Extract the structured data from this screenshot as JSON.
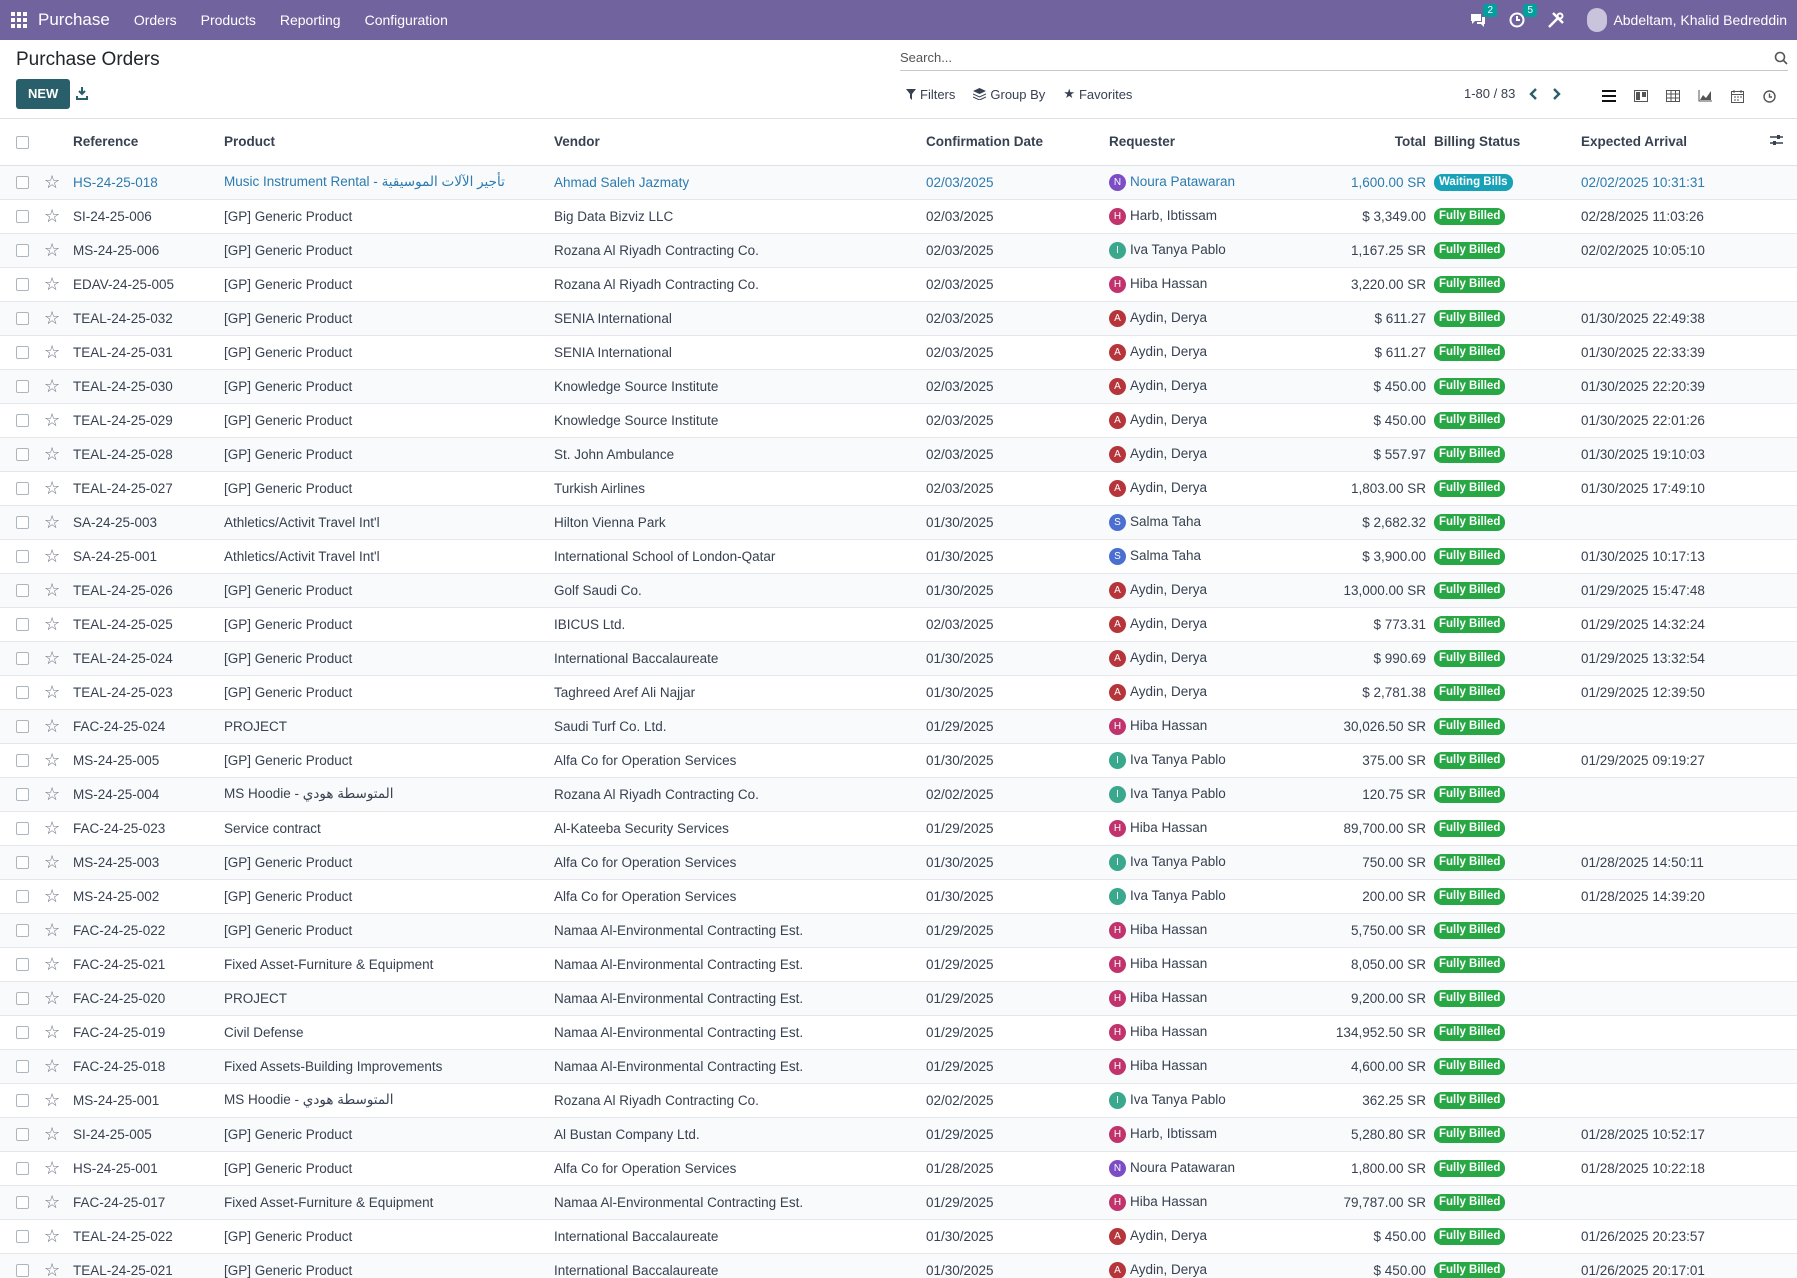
{
  "navbar": {
    "app_name": "Purchase",
    "menu": [
      "Orders",
      "Products",
      "Reporting",
      "Configuration"
    ],
    "messages_count": "2",
    "activities_count": "5",
    "user_name": "Abdeltam, Khalid Bedreddin"
  },
  "control": {
    "title": "Purchase Orders",
    "new_label": "NEW",
    "search_placeholder": "Search...",
    "filters_label": "Filters",
    "groupby_label": "Group By",
    "favorites_label": "Favorites",
    "pager": "1-80 / 83"
  },
  "table": {
    "headers": [
      "Reference",
      "Product",
      "Vendor",
      "Confirmation Date",
      "Requester",
      "Total",
      "Billing Status",
      "Expected Arrival"
    ],
    "rows": [
      {
        "ref": "HS-24-25-018",
        "product": "Music Instrument Rental - تأجير الآلات الموسيقية",
        "vendor": "Ahmad Saleh Jazmaty",
        "date": "02/03/2025",
        "initial": "N",
        "requester": "Noura Patawaran",
        "total": "1,600.00 SR",
        "status": "Waiting Bills",
        "arrival": "02/02/2025 10:31:31",
        "highlight": true
      },
      {
        "ref": "SI-24-25-006",
        "product": "[GP] Generic Product",
        "vendor": "Big Data Bizviz LLC",
        "date": "02/03/2025",
        "initial": "H",
        "requester": "Harb, Ibtissam",
        "total": "$ 3,349.00",
        "status": "Fully Billed",
        "arrival": "02/28/2025 11:03:26"
      },
      {
        "ref": "MS-24-25-006",
        "product": "[GP] Generic Product",
        "vendor": "Rozana Al Riyadh Contracting Co.",
        "date": "02/03/2025",
        "initial": "I",
        "requester": "Iva Tanya Pablo",
        "total": "1,167.25 SR",
        "status": "Fully Billed",
        "arrival": "02/02/2025 10:05:10"
      },
      {
        "ref": "EDAV-24-25-005",
        "product": "[GP] Generic Product",
        "vendor": "Rozana Al Riyadh Contracting Co.",
        "date": "02/03/2025",
        "initial": "H",
        "requester": "Hiba Hassan",
        "total": "3,220.00 SR",
        "status": "Fully Billed",
        "arrival": ""
      },
      {
        "ref": "TEAL-24-25-032",
        "product": "[GP] Generic Product",
        "vendor": "SENIA International",
        "date": "02/03/2025",
        "initial": "A",
        "requester": "Aydin, Derya",
        "total": "$ 611.27",
        "status": "Fully Billed",
        "arrival": "01/30/2025 22:49:38"
      },
      {
        "ref": "TEAL-24-25-031",
        "product": "[GP] Generic Product",
        "vendor": "SENIA International",
        "date": "02/03/2025",
        "initial": "A",
        "requester": "Aydin, Derya",
        "total": "$ 611.27",
        "status": "Fully Billed",
        "arrival": "01/30/2025 22:33:39"
      },
      {
        "ref": "TEAL-24-25-030",
        "product": "[GP] Generic Product",
        "vendor": "Knowledge Source Institute",
        "date": "02/03/2025",
        "initial": "A",
        "requester": "Aydin, Derya",
        "total": "$ 450.00",
        "status": "Fully Billed",
        "arrival": "01/30/2025 22:20:39"
      },
      {
        "ref": "TEAL-24-25-029",
        "product": "[GP] Generic Product",
        "vendor": "Knowledge Source Institute",
        "date": "02/03/2025",
        "initial": "A",
        "requester": "Aydin, Derya",
        "total": "$ 450.00",
        "status": "Fully Billed",
        "arrival": "01/30/2025 22:01:26"
      },
      {
        "ref": "TEAL-24-25-028",
        "product": "[GP] Generic Product",
        "vendor": "St. John Ambulance",
        "date": "02/03/2025",
        "initial": "A",
        "requester": "Aydin, Derya",
        "total": "$ 557.97",
        "status": "Fully Billed",
        "arrival": "01/30/2025 19:10:03"
      },
      {
        "ref": "TEAL-24-25-027",
        "product": "[GP] Generic Product",
        "vendor": "Turkish Airlines",
        "date": "02/03/2025",
        "initial": "A",
        "requester": "Aydin, Derya",
        "total": "1,803.00 SR",
        "status": "Fully Billed",
        "arrival": "01/30/2025 17:49:10"
      },
      {
        "ref": "SA-24-25-003",
        "product": "Athletics/Activit Travel Int'l",
        "vendor": "Hilton Vienna Park",
        "date": "01/30/2025",
        "initial": "S",
        "requester": "Salma Taha",
        "total": "$ 2,682.32",
        "status": "Fully Billed",
        "arrival": ""
      },
      {
        "ref": "SA-24-25-001",
        "product": "Athletics/Activit Travel Int'l",
        "vendor": "International School of London-Qatar",
        "date": "01/30/2025",
        "initial": "S",
        "requester": "Salma Taha",
        "total": "$ 3,900.00",
        "status": "Fully Billed",
        "arrival": "01/30/2025 10:17:13"
      },
      {
        "ref": "TEAL-24-25-026",
        "product": "[GP] Generic Product",
        "vendor": "Golf Saudi Co.",
        "date": "01/30/2025",
        "initial": "A",
        "requester": "Aydin, Derya",
        "total": "13,000.00 SR",
        "status": "Fully Billed",
        "arrival": "01/29/2025 15:47:48"
      },
      {
        "ref": "TEAL-24-25-025",
        "product": "[GP] Generic Product",
        "vendor": "IBICUS Ltd.",
        "date": "02/03/2025",
        "initial": "A",
        "requester": "Aydin, Derya",
        "total": "$ 773.31",
        "status": "Fully Billed",
        "arrival": "01/29/2025 14:32:24"
      },
      {
        "ref": "TEAL-24-25-024",
        "product": "[GP] Generic Product",
        "vendor": "International Baccalaureate",
        "date": "01/30/2025",
        "initial": "A",
        "requester": "Aydin, Derya",
        "total": "$ 990.69",
        "status": "Fully Billed",
        "arrival": "01/29/2025 13:32:54"
      },
      {
        "ref": "TEAL-24-25-023",
        "product": "[GP] Generic Product",
        "vendor": "Taghreed Aref Ali Najjar",
        "date": "01/30/2025",
        "initial": "A",
        "requester": "Aydin, Derya",
        "total": "$ 2,781.38",
        "status": "Fully Billed",
        "arrival": "01/29/2025 12:39:50"
      },
      {
        "ref": "FAC-24-25-024",
        "product": "PROJECT",
        "vendor": "Saudi Turf Co. Ltd.",
        "date": "01/29/2025",
        "initial": "H",
        "requester": "Hiba Hassan",
        "total": "30,026.50 SR",
        "status": "Fully Billed",
        "arrival": ""
      },
      {
        "ref": "MS-24-25-005",
        "product": "[GP] Generic Product",
        "vendor": "Alfa Co for Operation Services",
        "date": "01/30/2025",
        "initial": "I",
        "requester": "Iva Tanya Pablo",
        "total": "375.00 SR",
        "status": "Fully Billed",
        "arrival": "01/29/2025 09:19:27"
      },
      {
        "ref": "MS-24-25-004",
        "product": "MS Hoodie - المتوسطة هودي",
        "vendor": "Rozana Al Riyadh Contracting Co.",
        "date": "02/02/2025",
        "initial": "I",
        "requester": "Iva Tanya Pablo",
        "total": "120.75 SR",
        "status": "Fully Billed",
        "arrival": ""
      },
      {
        "ref": "FAC-24-25-023",
        "product": "Service contract",
        "vendor": "Al-Kateeba Security Services",
        "date": "01/29/2025",
        "initial": "H",
        "requester": "Hiba Hassan",
        "total": "89,700.00 SR",
        "status": "Fully Billed",
        "arrival": ""
      },
      {
        "ref": "MS-24-25-003",
        "product": "[GP] Generic Product",
        "vendor": "Alfa Co for Operation Services",
        "date": "01/30/2025",
        "initial": "I",
        "requester": "Iva Tanya Pablo",
        "total": "750.00 SR",
        "status": "Fully Billed",
        "arrival": "01/28/2025 14:50:11"
      },
      {
        "ref": "MS-24-25-002",
        "product": "[GP] Generic Product",
        "vendor": "Alfa Co for Operation Services",
        "date": "01/30/2025",
        "initial": "I",
        "requester": "Iva Tanya Pablo",
        "total": "200.00 SR",
        "status": "Fully Billed",
        "arrival": "01/28/2025 14:39:20"
      },
      {
        "ref": "FAC-24-25-022",
        "product": "[GP] Generic Product",
        "vendor": "Namaa Al-Environmental Contracting Est.",
        "date": "01/29/2025",
        "initial": "H",
        "requester": "Hiba Hassan",
        "total": "5,750.00 SR",
        "status": "Fully Billed",
        "arrival": ""
      },
      {
        "ref": "FAC-24-25-021",
        "product": "Fixed Asset-Furniture & Equipment",
        "vendor": "Namaa Al-Environmental Contracting Est.",
        "date": "01/29/2025",
        "initial": "H",
        "requester": "Hiba Hassan",
        "total": "8,050.00 SR",
        "status": "Fully Billed",
        "arrival": ""
      },
      {
        "ref": "FAC-24-25-020",
        "product": "PROJECT",
        "vendor": "Namaa Al-Environmental Contracting Est.",
        "date": "01/29/2025",
        "initial": "H",
        "requester": "Hiba Hassan",
        "total": "9,200.00 SR",
        "status": "Fully Billed",
        "arrival": ""
      },
      {
        "ref": "FAC-24-25-019",
        "product": "Civil Defense",
        "vendor": "Namaa Al-Environmental Contracting Est.",
        "date": "01/29/2025",
        "initial": "H",
        "requester": "Hiba Hassan",
        "total": "134,952.50 SR",
        "status": "Fully Billed",
        "arrival": ""
      },
      {
        "ref": "FAC-24-25-018",
        "product": "Fixed Assets-Building Improvements",
        "vendor": "Namaa Al-Environmental Contracting Est.",
        "date": "01/29/2025",
        "initial": "H",
        "requester": "Hiba Hassan",
        "total": "4,600.00 SR",
        "status": "Fully Billed",
        "arrival": ""
      },
      {
        "ref": "MS-24-25-001",
        "product": "MS Hoodie - المتوسطة هودي",
        "vendor": "Rozana Al Riyadh Contracting Co.",
        "date": "02/02/2025",
        "initial": "I",
        "requester": "Iva Tanya Pablo",
        "total": "362.25 SR",
        "status": "Fully Billed",
        "arrival": ""
      },
      {
        "ref": "SI-24-25-005",
        "product": "[GP] Generic Product",
        "vendor": "Al Bustan Company Ltd.",
        "date": "01/29/2025",
        "initial": "H",
        "requester": "Harb, Ibtissam",
        "total": "5,280.80 SR",
        "status": "Fully Billed",
        "arrival": "01/28/2025 10:52:17"
      },
      {
        "ref": "HS-24-25-001",
        "product": "[GP] Generic Product",
        "vendor": "Alfa Co for Operation Services",
        "date": "01/28/2025",
        "initial": "N",
        "requester": "Noura Patawaran",
        "total": "1,800.00 SR",
        "status": "Fully Billed",
        "arrival": "01/28/2025 10:22:18"
      },
      {
        "ref": "FAC-24-25-017",
        "product": "Fixed Asset-Furniture & Equipment",
        "vendor": "Namaa Al-Environmental Contracting Est.",
        "date": "01/29/2025",
        "initial": "H",
        "requester": "Hiba Hassan",
        "total": "79,787.00 SR",
        "status": "Fully Billed",
        "arrival": ""
      },
      {
        "ref": "TEAL-24-25-022",
        "product": "[GP] Generic Product",
        "vendor": "International Baccalaureate",
        "date": "01/30/2025",
        "initial": "A",
        "requester": "Aydin, Derya",
        "total": "$ 450.00",
        "status": "Fully Billed",
        "arrival": "01/26/2025 20:23:57"
      },
      {
        "ref": "TEAL-24-25-021",
        "product": "[GP] Generic Product",
        "vendor": "International Baccalaureate",
        "date": "01/30/2025",
        "initial": "A",
        "requester": "Aydin, Derya",
        "total": "$ 450.00",
        "status": "Fully Billed",
        "arrival": "01/26/2025 20:17:01"
      }
    ]
  }
}
